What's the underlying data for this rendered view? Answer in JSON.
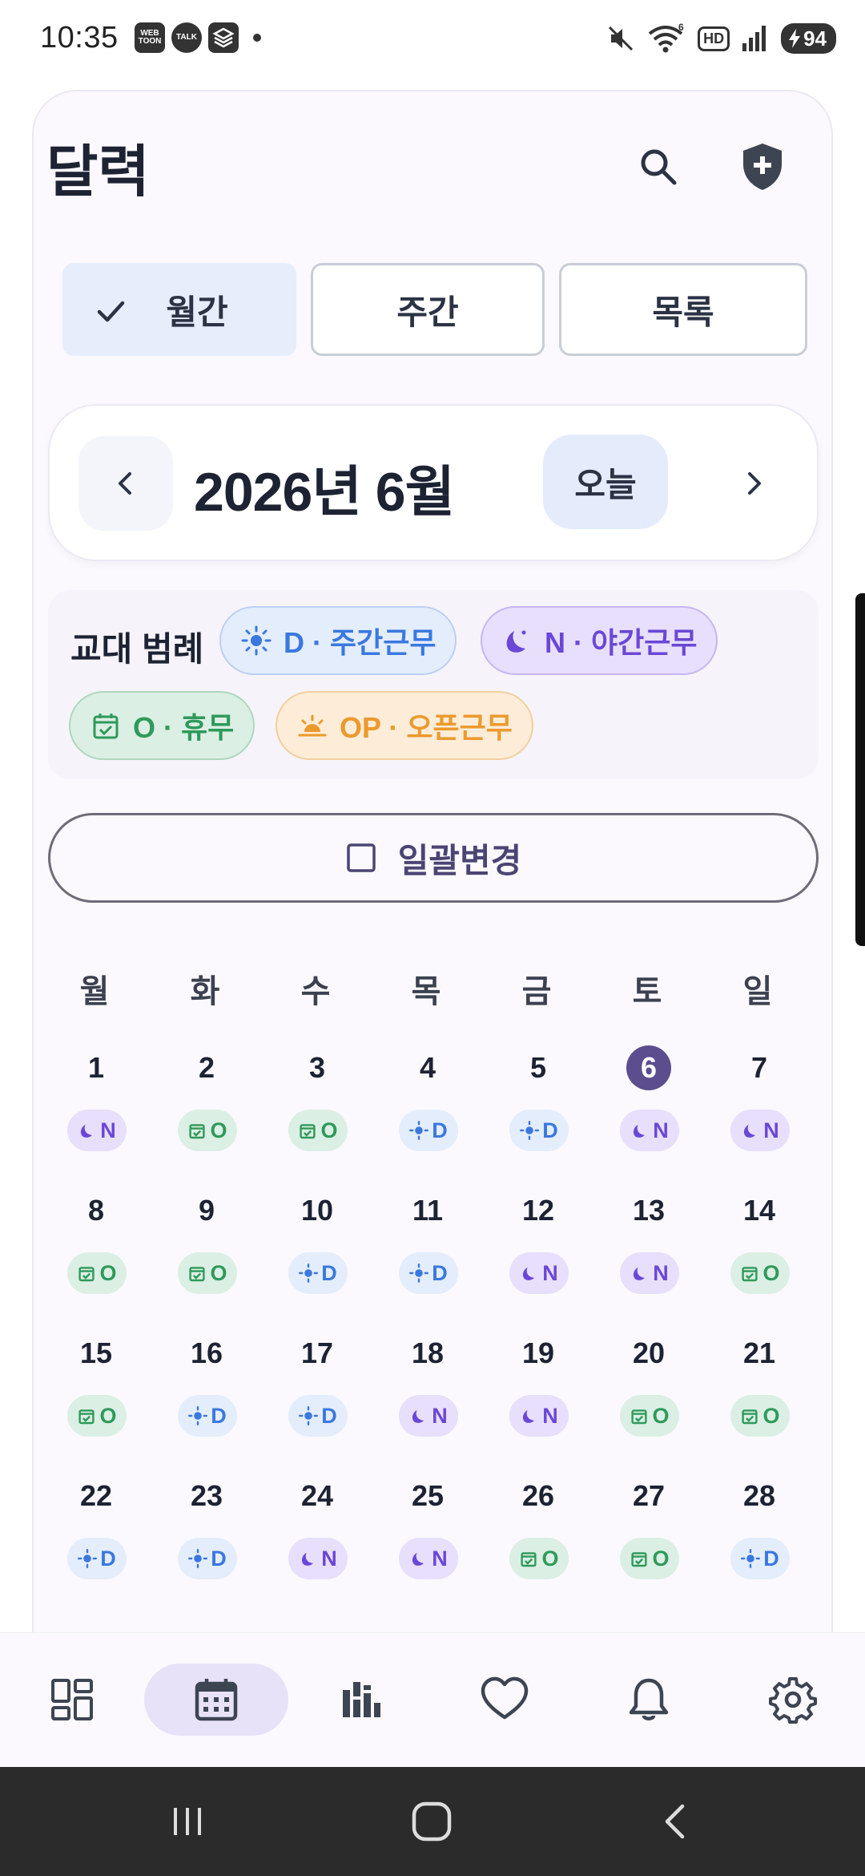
{
  "status_bar": {
    "time": "10:35",
    "notifications": [
      {
        "icon": "webtoon-icon",
        "label": "WEB TOON"
      },
      {
        "icon": "kakaotalk-icon",
        "label": "TALK"
      },
      {
        "icon": "app-stack-icon",
        "label": ""
      }
    ],
    "battery": "94",
    "wifi_badge": "6",
    "hd_label": "HD"
  },
  "header": {
    "title": "달력",
    "search_icon": "search-icon",
    "shield_icon": "shield-plus-icon"
  },
  "view_tabs": [
    {
      "label": "월간",
      "active": true
    },
    {
      "label": "주간",
      "active": false
    },
    {
      "label": "목록",
      "active": false
    }
  ],
  "month_nav": {
    "label": "2026년 6월",
    "today_label": "오늘"
  },
  "legend": {
    "title": "교대 범례",
    "items": [
      {
        "code": "D",
        "label": "D · 주간근무",
        "icon": "sun-icon",
        "color": "#3a78e0"
      },
      {
        "code": "N",
        "label": "N · 야간근무",
        "icon": "moon-icon",
        "color": "#6a47d6"
      },
      {
        "code": "O",
        "label": "O · 휴무",
        "icon": "calendar-check-icon",
        "color": "#2e9a5a"
      },
      {
        "code": "OP",
        "label": "OP · 오픈근무",
        "icon": "sunrise-icon",
        "color": "#ec9a2d"
      }
    ]
  },
  "bulk_change": {
    "label": "일괄변경"
  },
  "calendar": {
    "weekdays": [
      "월",
      "화",
      "수",
      "목",
      "금",
      "토",
      "일"
    ],
    "today": 6,
    "days": [
      {
        "day": "1",
        "shift": "N"
      },
      {
        "day": "2",
        "shift": "O"
      },
      {
        "day": "3",
        "shift": "O"
      },
      {
        "day": "4",
        "shift": "D"
      },
      {
        "day": "5",
        "shift": "D"
      },
      {
        "day": "6",
        "shift": "N"
      },
      {
        "day": "7",
        "shift": "N"
      },
      {
        "day": "8",
        "shift": "O"
      },
      {
        "day": "9",
        "shift": "O"
      },
      {
        "day": "10",
        "shift": "D"
      },
      {
        "day": "11",
        "shift": "D"
      },
      {
        "day": "12",
        "shift": "N"
      },
      {
        "day": "13",
        "shift": "N"
      },
      {
        "day": "14",
        "shift": "O"
      },
      {
        "day": "15",
        "shift": "O"
      },
      {
        "day": "16",
        "shift": "D"
      },
      {
        "day": "17",
        "shift": "D"
      },
      {
        "day": "18",
        "shift": "N"
      },
      {
        "day": "19",
        "shift": "N"
      },
      {
        "day": "20",
        "shift": "O"
      },
      {
        "day": "21",
        "shift": "O"
      },
      {
        "day": "22",
        "shift": "D"
      },
      {
        "day": "23",
        "shift": "D"
      },
      {
        "day": "24",
        "shift": "N"
      },
      {
        "day": "25",
        "shift": "N"
      },
      {
        "day": "26",
        "shift": "O"
      },
      {
        "day": "27",
        "shift": "O"
      },
      {
        "day": "28",
        "shift": "D"
      }
    ]
  },
  "bottom_nav": [
    {
      "icon": "dashboard-icon",
      "active": false
    },
    {
      "icon": "calendar-icon",
      "active": true
    },
    {
      "icon": "stats-icon",
      "active": false
    },
    {
      "icon": "heart-icon",
      "active": false
    },
    {
      "icon": "bell-icon",
      "active": false
    },
    {
      "icon": "gear-icon",
      "active": false
    }
  ],
  "system_nav": [
    {
      "icon": "recents-icon"
    },
    {
      "icon": "home-icon"
    },
    {
      "icon": "back-icon"
    }
  ]
}
